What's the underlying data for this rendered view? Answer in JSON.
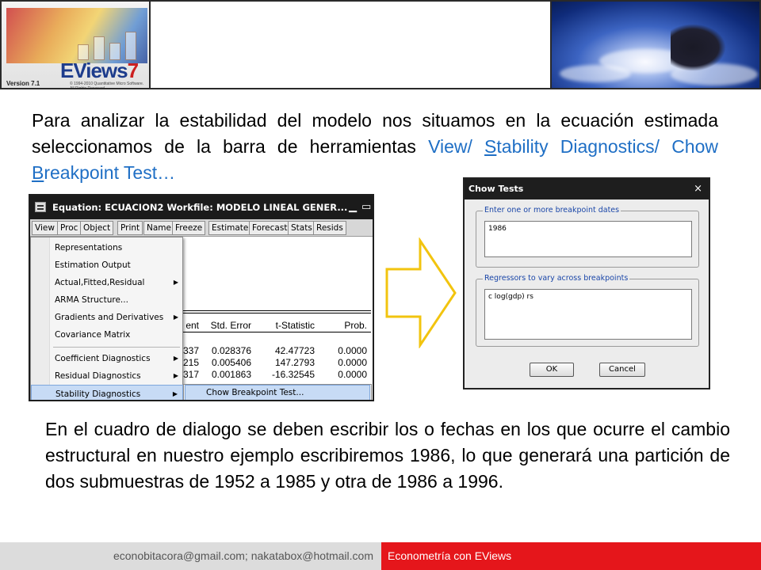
{
  "banner": {
    "logo_text": "EViews",
    "logo_number": "7",
    "version": "Version 7.1",
    "copyright": "© 1994-2010 Quantitative Micro Software. All Rights Reserved."
  },
  "paragraph1": {
    "text_before": "Para analizar la estabilidad del modelo nos situamos en la ecuación estimada seleccionamos de la barra de herramientas ",
    "link_view": "View/ ",
    "link_s": "S",
    "link_tability": "tability",
    "link_diag": "Diagnostics/ Chow ",
    "link_b": "B",
    "link_reakpoint": "reakpoint Test…"
  },
  "eviews_window": {
    "title": "Equation: ECUACION2   Workfile: MODELO LINEAL GENER...",
    "toolbar": [
      "View",
      "Proc",
      "Object",
      "Print",
      "Name",
      "Freeze",
      "Estimate",
      "Forecast",
      "Stats",
      "Resids"
    ],
    "menu": [
      {
        "label": "Representations",
        "submenu": false
      },
      {
        "label": "Estimation Output",
        "submenu": false
      },
      {
        "label": "Actual,Fitted,Residual",
        "submenu": true
      },
      {
        "label": "ARMA Structure...",
        "submenu": false
      },
      {
        "label": "Gradients and Derivatives",
        "submenu": true
      },
      {
        "label": "Covariance Matrix",
        "submenu": false
      },
      {
        "label": "Coefficient Diagnostics",
        "submenu": true
      },
      {
        "label": "Residual Diagnostics",
        "submenu": true
      },
      {
        "label": "Stability Diagnostics",
        "submenu": true
      }
    ],
    "submenu_item": "Chow Breakpoint Test...",
    "table": {
      "headers": [
        "ent",
        "Std. Error",
        "t-Statistic",
        "Prob."
      ],
      "rows": [
        [
          "337",
          "0.028376",
          "42.47723",
          "0.0000"
        ],
        [
          "215",
          "0.005406",
          "147.2793",
          "0.0000"
        ],
        [
          "317",
          "0.001863",
          "-16.32545",
          "0.0000"
        ]
      ]
    }
  },
  "chow_dialog": {
    "title": "Chow Tests",
    "close_symbol": "×",
    "group1_label": "Enter one or more breakpoint dates",
    "group1_value": "1986",
    "group2_label": "Regressors to vary across breakpoints",
    "group2_value": "c log(gdp) rs",
    "ok_label": "OK",
    "cancel_label": "Cancel"
  },
  "paragraph2": "En el cuadro de dialogo se deben escribir los o fechas en los que ocurre el cambio estructural en nuestro ejemplo escribiremos 1986, lo que generará una partición de dos submuestras de 1952 a 1985 y otra de 1986 a 1996.",
  "footer": {
    "left": "econobitacora@gmail.com;  nakatabox@hotmail.com",
    "right": "Econometría con EViews"
  },
  "colors": {
    "link": "#1f6fc5",
    "footer_red": "#e5161b",
    "footer_gray": "#dcdcdc",
    "arrow_yellow": "#f2c40f"
  }
}
